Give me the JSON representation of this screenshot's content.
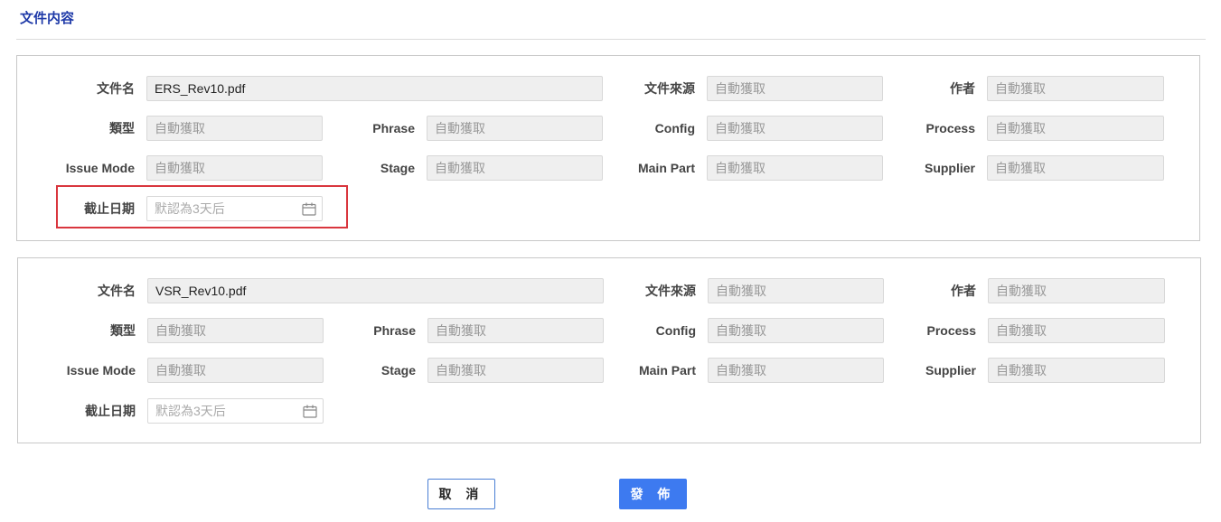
{
  "section": {
    "title": "文件内容"
  },
  "labels": {
    "filename": "文件名",
    "source": "文件來源",
    "author": "作者",
    "type": "類型",
    "phrase": "Phrase",
    "config": "Config",
    "process": "Process",
    "issue_mode": "Issue Mode",
    "stage": "Stage",
    "main_part": "Main Part",
    "supplier": "Supplier",
    "deadline": "截止日期"
  },
  "documents": [
    {
      "filename": "ERS_Rev10.pdf",
      "source": "自動獲取",
      "author": "自動獲取",
      "type": "自動獲取",
      "phrase": "自動獲取",
      "config": "自動獲取",
      "process": "自動獲取",
      "issue_mode": "自動獲取",
      "stage": "自動獲取",
      "main_part": "自動獲取",
      "supplier": "自動獲取",
      "deadline_placeholder": "默認為3天后"
    },
    {
      "filename": "VSR_Rev10.pdf",
      "source": "自動獲取",
      "author": "自動獲取",
      "type": "自動獲取",
      "phrase": "自動獲取",
      "config": "自動獲取",
      "process": "自動獲取",
      "issue_mode": "自動獲取",
      "stage": "自動獲取",
      "main_part": "自動獲取",
      "supplier": "自動獲取",
      "deadline_placeholder": "默認為3天后"
    }
  ],
  "buttons": {
    "cancel": "取 消",
    "publish": "發 佈"
  },
  "icons": {
    "calendar": "calendar-icon"
  },
  "colors": {
    "title": "#1f3aa8",
    "highlight": "#d9363e",
    "primary": "#3d7af0"
  }
}
